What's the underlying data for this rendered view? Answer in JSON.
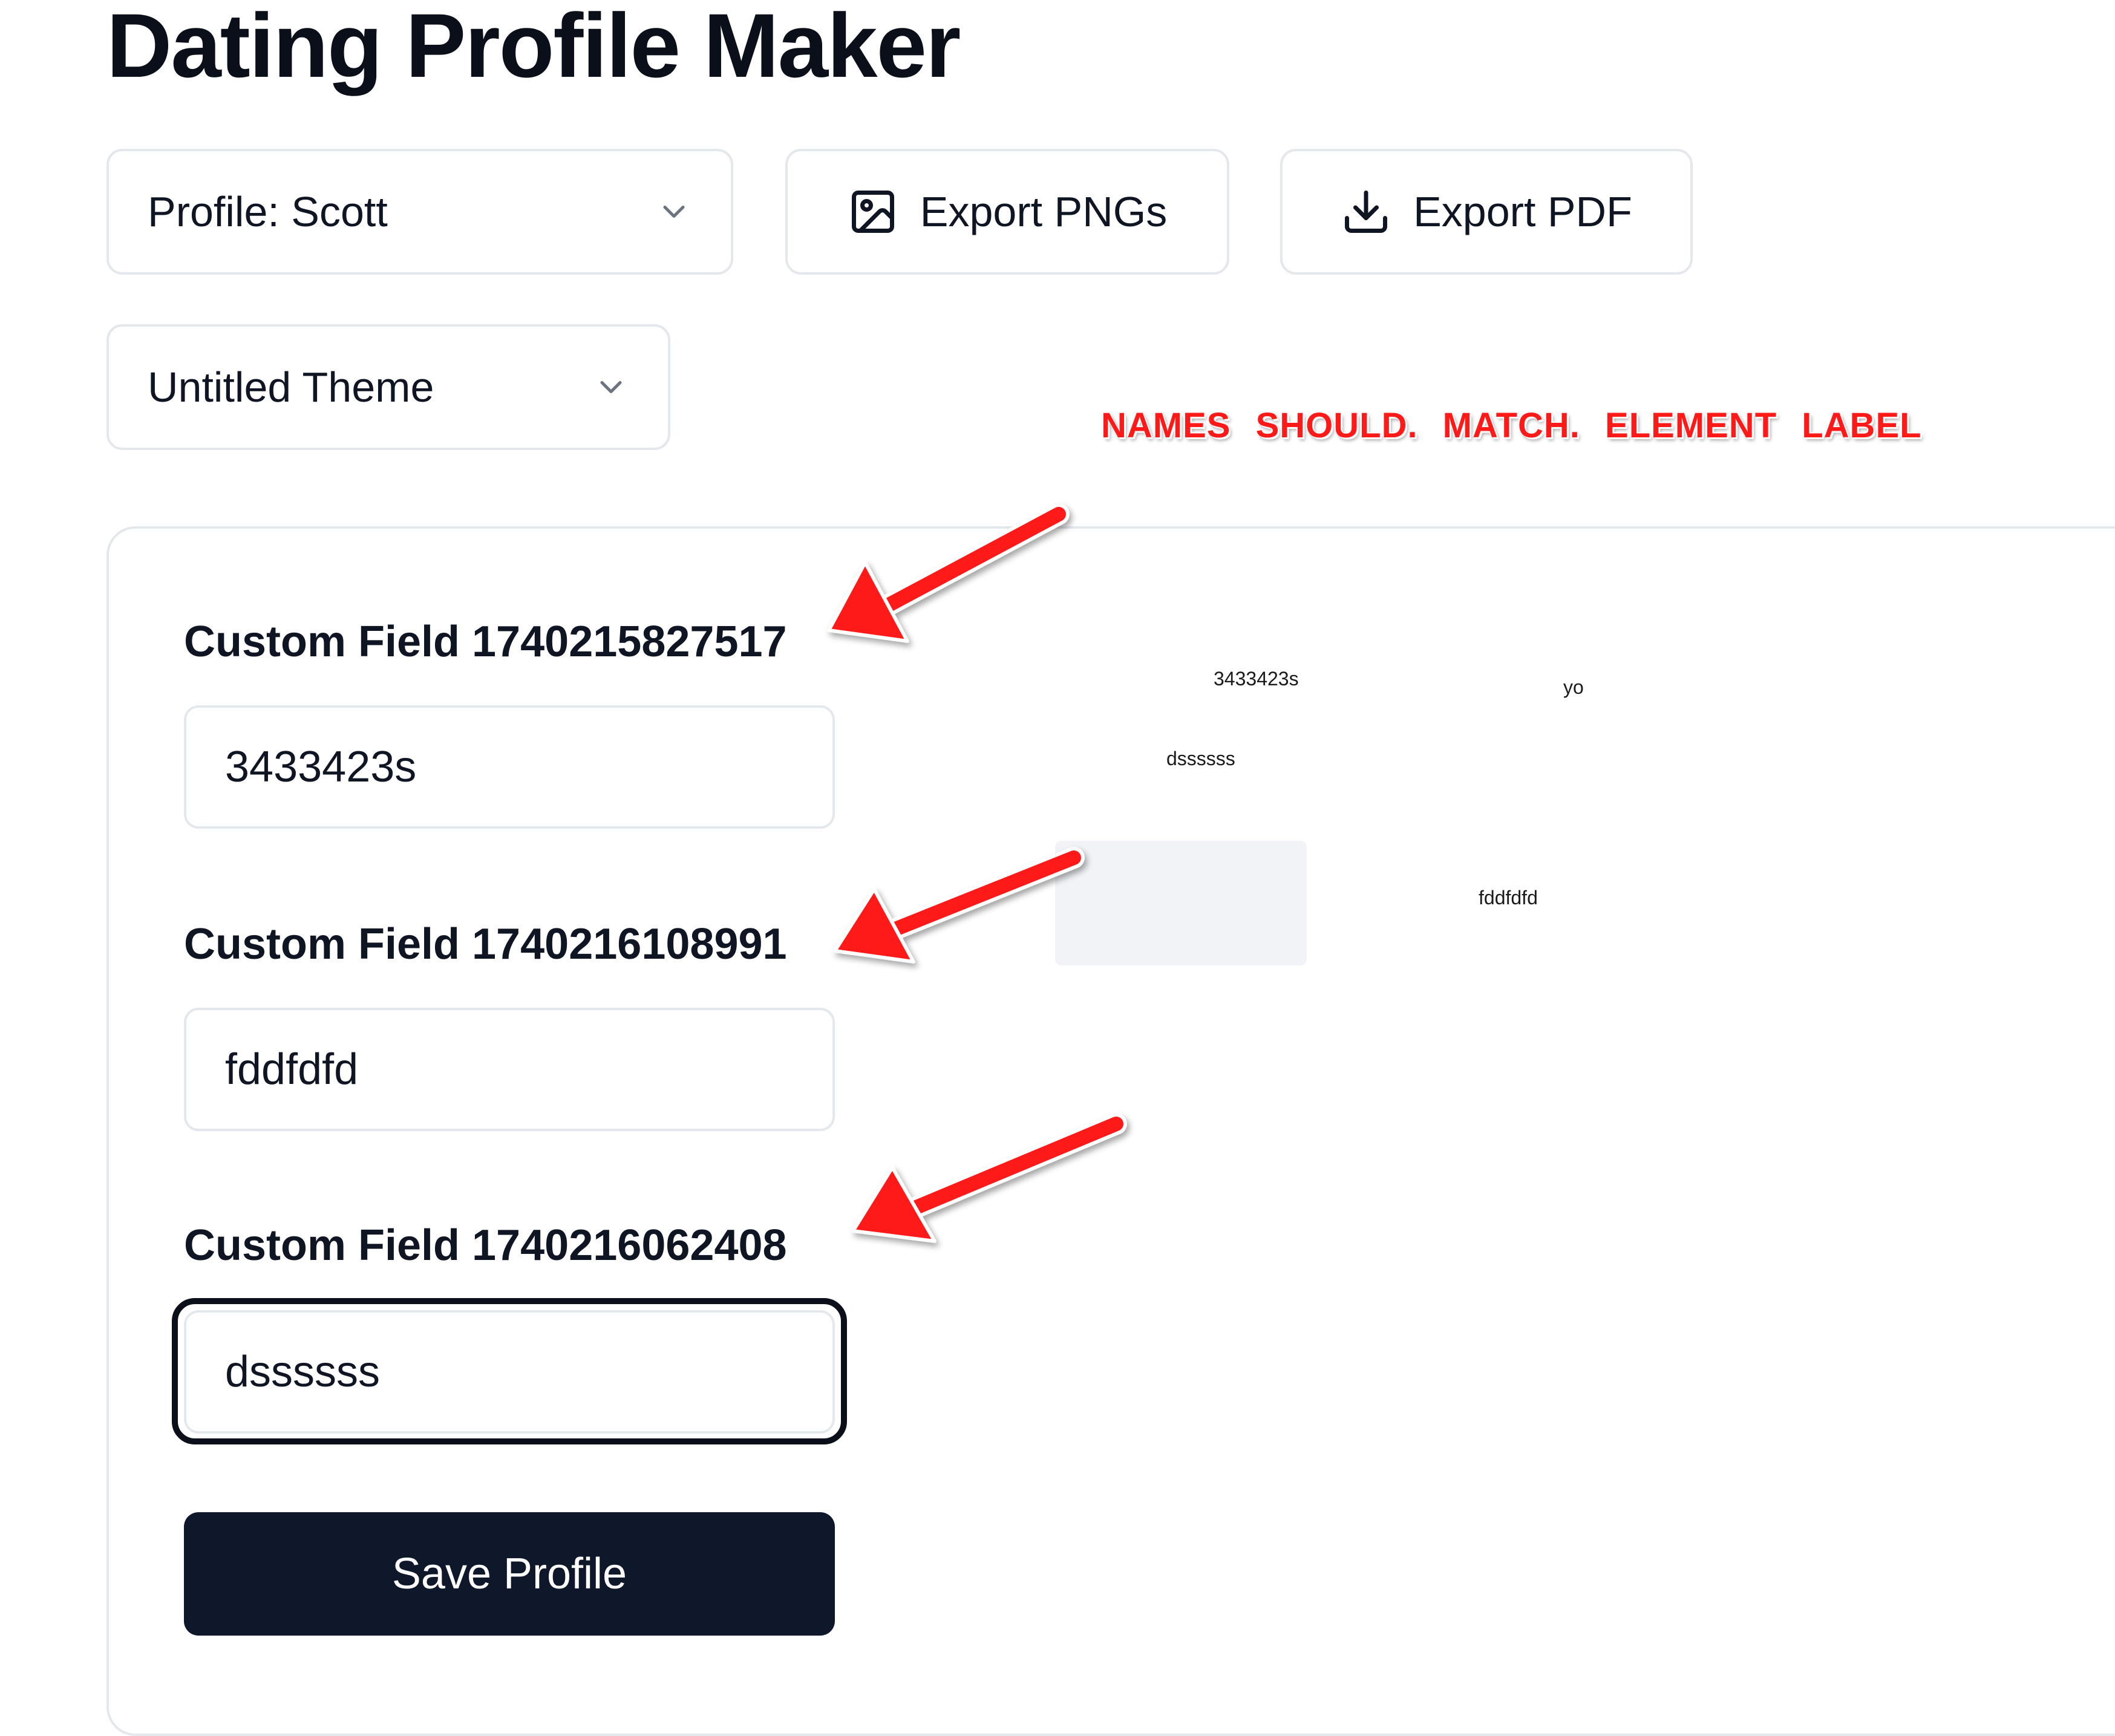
{
  "page": {
    "title": "Dating Profile Maker"
  },
  "toolbar": {
    "profile_select": "Profile: Scott",
    "export_pngs_label": "Export PNGs",
    "export_pdf_label": "Export PDF",
    "theme_select": "Untitled Theme"
  },
  "annotation": {
    "text": "NAMES  SHOULD. MATCH. ELEMENT  LABEL",
    "color": "#ff1a1a"
  },
  "form": {
    "fields": [
      {
        "label": "Custom Field 1740215827517",
        "value": "3433423s"
      },
      {
        "label": "Custom Field 1740216108991",
        "value": "fddfdfd"
      },
      {
        "label": "Custom Field 1740216062408",
        "value": "dssssss"
      }
    ],
    "save_label": "Save Profile"
  },
  "preview": {
    "items": [
      "3433423s",
      "yo",
      "dssssss",
      "fddfdfd"
    ]
  },
  "colors": {
    "primary_button": "#0f172a",
    "border": "#e4e7ec",
    "annotation_arrow": "#ff1a1a"
  },
  "icons": {
    "chevron": "chevron-down-icon",
    "image": "image-icon",
    "download": "download-icon"
  }
}
